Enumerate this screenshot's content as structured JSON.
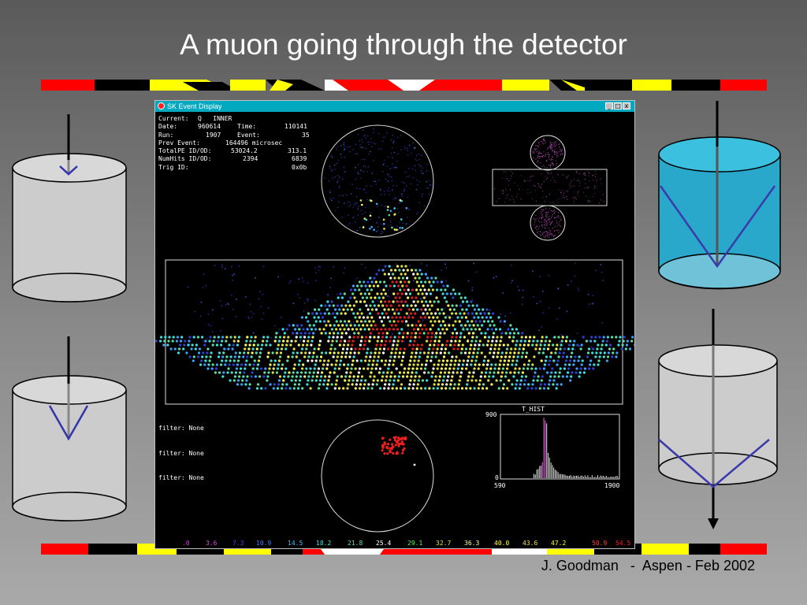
{
  "slide": {
    "title": "A muon going through the detector",
    "footer": "J. Goodman   -  Aspen - Feb 2002"
  },
  "window": {
    "title": "SK Event Display",
    "buttons": [
      "_",
      "□",
      "x"
    ]
  },
  "info": {
    "current_label": "Current:",
    "current_value": "Q   INNER",
    "date_label": "Date:",
    "date_value": "960614",
    "time_label": "Time:",
    "time_value": "110141",
    "run_label": "Run:",
    "run_value": "1907",
    "event_label": "Event:",
    "event_value": "35",
    "prev_label": "Prev Event:",
    "prev_value": "164496 microsec",
    "totalpe_label": "TotalPE ID/OD:",
    "totalpe_id": "53024.2",
    "totalpe_od": "313.1",
    "numhits_label": "NumHits ID/OD:",
    "numhits_id": "2394",
    "numhits_od": "6839",
    "trig_label": "Trig ID:",
    "trig_value": "0x0b"
  },
  "filters": [
    "filter: None",
    "filter: None",
    "filter: None"
  ],
  "histogram": {
    "title": "T_HIST",
    "y_max": "900",
    "y_min": "0",
    "x_min": "590",
    "x_max": "1900"
  },
  "color_scale": [
    {
      "label": ".0",
      "color": "#d040d0"
    },
    {
      "label": "3.6",
      "color": "#e040e0"
    },
    {
      "label": "7.3",
      "color": "#4040ff"
    },
    {
      "label": "10.9",
      "color": "#4080ff"
    },
    {
      "label": "14.5",
      "color": "#40c0ff"
    },
    {
      "label": "18.2",
      "color": "#40e0e0"
    },
    {
      "label": "21.8",
      "color": "#60e0c0"
    },
    {
      "label": "25.4",
      "color": "#ffffff"
    },
    {
      "label": "29.1",
      "color": "#40ff40"
    },
    {
      "label": "32.7",
      "color": "#e0e040"
    },
    {
      "label": "36.3",
      "color": "#ffffa0"
    },
    {
      "label": "40.0",
      "color": "#ffff40"
    },
    {
      "label": "43.6",
      "color": "#f0e040"
    },
    {
      "label": "47.2",
      "color": "#ffff00"
    },
    {
      "label": "50.9",
      "color": "#ff4040"
    },
    {
      "label": "54.5",
      "color": "#ff2020"
    }
  ],
  "colors": {
    "stripe_red": "#ff0000",
    "stripe_black": "#000000",
    "stripe_yellow": "#ffff00",
    "stripe_white": "#ffffff",
    "water": "#2aa8cc",
    "cherenkov": "#3a3aaa"
  }
}
